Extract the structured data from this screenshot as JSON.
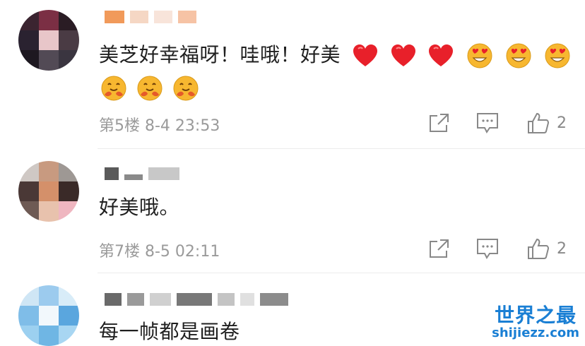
{
  "comments": [
    {
      "text": "美芝好幸福呀！哇哦！好美",
      "emojis_row1": [
        "heart",
        "heart",
        "heart",
        "heart-eyes",
        "heart-eyes",
        "heart-eyes"
      ],
      "emojis_row2": [
        "hug",
        "hug",
        "hug"
      ],
      "meta": "第5楼 8-4 23:53",
      "likes": "2"
    },
    {
      "text": "好美哦。",
      "meta": "第7楼 8-5 02:11",
      "likes": "2"
    },
    {
      "text": "每一帧都是画卷"
    }
  ],
  "watermark": {
    "line1": "世界之最",
    "line2": "shijiezz.com"
  },
  "colors": {
    "heart": "#e8202a",
    "emoji_face": "#f7b730",
    "meta_gray": "#9a9a9a",
    "watermark_blue": "#1a7fd4"
  }
}
